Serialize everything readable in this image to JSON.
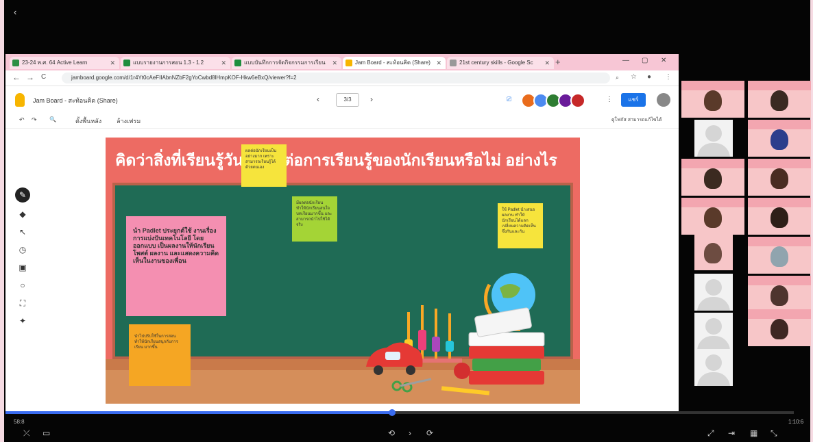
{
  "player": {
    "back": "‹",
    "progress_fraction": 0.49,
    "time_left": "58:8",
    "time_right": "1:10:6",
    "controls": [
      "⤫",
      "▭",
      "⟲",
      "›",
      "⟳",
      "⤢",
      "⇥",
      "▦",
      "⤡"
    ]
  },
  "browser": {
    "tabs": [
      {
        "label": "23-24 พ.ศ. 64 Active Learn",
        "color": "#2d8f45"
      },
      {
        "label": "แบบรายงานการสอน 1.3 - 1.2",
        "color": "#1e8e3e"
      },
      {
        "label": "แบบบันทึกการจัดกิจกรรมการเรียน",
        "color": "#1e8e3e"
      },
      {
        "label": "Jam Board - สะท้อนคิด (Share)",
        "color": "#f7b500"
      },
      {
        "label": "21st century skills - Google Sc",
        "color": "#999999"
      }
    ],
    "new_tab": "+",
    "window_controls": [
      "—",
      "▢",
      "✕"
    ],
    "nav": [
      "←",
      "→",
      "C"
    ],
    "url": "jamboard.google.com/d/1r4Yt0cAeFIIAbnNZbF2gYoCwbd8lHmpKOF-Hkw6eBxQ/viewer?f=2"
  },
  "app": {
    "title": "Jam Board - สะท้อนคิด (Share)",
    "frame_nav": {
      "prev": "‹",
      "current": "3/3",
      "next": "›"
    },
    "present_icon": "cast-icon",
    "avatar_colors": [
      "#e96c1c",
      "#4c8af0",
      "#2e7d32",
      "#6a1b9a",
      "#c62828"
    ],
    "share": "แชร์",
    "toolbar": {
      "undo": "↶",
      "redo": "↷",
      "zoom": "🔍",
      "set_background": "ตั้งพื้นหลัง",
      "clear_frame": "ล้างเฟรม",
      "more_text": "ดูโฟกัส สามารถแก้ไขได้"
    }
  },
  "tools": [
    "pen-icon",
    "eraser-icon",
    "select-icon",
    "sticky-note-icon",
    "image-icon",
    "circle-icon",
    "text-box-icon",
    "laser-icon"
  ],
  "frame": {
    "title": "คิดว่าสิ่งที่เรียนรู้วันนี้มีผลต่อการเรียนรู้ของนักเรียนหรือไม่ อย่างไร",
    "notes": [
      {
        "text": "ผลต่อนักเรียนเป็นอย่างมาก เพราะสามารถเรียนรู้ได้ด้วยตนเอง",
        "color": "#f6e43c"
      },
      {
        "text": "มีผลต่อนักเรียน ทำให้นักเรียนสนใจบทเรียนมากขึ้น และสามารถนำไปใช้ได้จริง",
        "color": "#a4d436"
      },
      {
        "text": "ใช้ Padlet นำเสนอผลงาน ทำให้นักเรียนได้แลกเปลี่ยนความคิดเห็นซึ่งกันและกัน",
        "color": "#f6e43c"
      },
      {
        "text": "นำ Padlet ประยุกต์ใช้ งานเรื่องการแบ่งปันเทคโนโลยี โดยออกแบบ เป็นผลงานให้นักเรียนโพสต์ ผลงาน และแสดงความคิดเห็นในงานของเพื่อน",
        "color": "#f48fb1"
      },
      {
        "text": "นำไปปรับใช้ในการสอน ทำให้นักเรียนสนุกกับการเรียน มากขึ้น",
        "color": "#f5a623"
      }
    ]
  }
}
